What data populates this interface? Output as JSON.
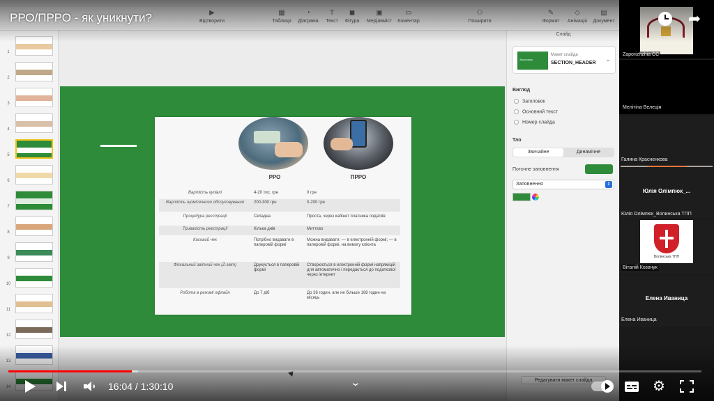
{
  "video": {
    "title": "РРО/ПРРО - як уникнути?",
    "time_current": "16:04",
    "time_total": "1:30:10",
    "time_display": "16:04 / 1:30:10",
    "progress_fraction": 0.178,
    "buffer_fraction": 0.187,
    "accent_color": "#ff0000"
  },
  "keynote": {
    "toolbar": {
      "play": "Відтворити",
      "table": "Таблиця",
      "chart": "Діаграма",
      "text": "Текст",
      "shape": "Фігура",
      "media": "Медіавміст",
      "comment": "Коментар",
      "share": "Поширити",
      "format": "Формат",
      "animate": "Анімація",
      "document": "Документ"
    },
    "navigator": {
      "numbers": [
        "1",
        "2",
        "3",
        "4",
        "5",
        "6",
        "7",
        "8",
        "9",
        "10",
        "11",
        "12",
        "13",
        "14"
      ],
      "selected_index": 4
    },
    "slide": {
      "background_color": "#2e8b3a",
      "image": {
        "col_rro": "РРО",
        "col_prro": "ПРРО",
        "rows": [
          {
            "label": "Вартість купівлі",
            "rro": "4-20 тис. грн",
            "prro": "0 грн"
          },
          {
            "label": "Вартість щомісячного обслуговування",
            "rro": "200-300 грн",
            "prro": "0-200 грн"
          },
          {
            "label": "Процедура реєстрації",
            "rro": "Складна",
            "prro": "Проста, через кабінет платника податків"
          },
          {
            "label": "Тривалість реєстрації",
            "rro": "Кілька днів",
            "prro": "Миттєво"
          },
          {
            "label": "Касовий чек",
            "rro": "Потрібно видавати в паперовій формі",
            "prro": "Можна видавати: — в електронній формі; — в паперовій формі, на вимогу клієнта"
          },
          {
            "label": "Фіскальний звітний чек (Z-звіт)",
            "rro": "Друкується в паперовій формі",
            "prro": "Створюється в електронній формі напряміцій для автоматично і передається до податкової через інтернет"
          },
          {
            "label": "Робота в режимі офлайн",
            "rro": "До 7 діб",
            "prro": "До 36 годин, але не більше 168 годин на місяць"
          }
        ]
      }
    },
    "inspector": {
      "title": "Слайд",
      "layout_label": "Макет слайда",
      "layout_value": "SECTION_HEADER",
      "layout_thumb_text": "Заголовок",
      "appearance_heading": "Вигляд",
      "appearance_options": [
        "Заголовок",
        "Основний текст",
        "Номер слайда"
      ],
      "background_heading": "Тло",
      "segment_static": "Звичайне",
      "segment_dynamic": "Динамічне",
      "current_fill": "Поточне заповнення",
      "fill_type": "Заповнення",
      "fill_color": "#2e8b3a",
      "edit_layout": "Редагувати макет слайда"
    }
  },
  "participants": [
    {
      "name": "Zaporizhzhia CC"
    },
    {
      "name": "Мелітіна Велеція"
    },
    {
      "name": "Галина Красненкова"
    },
    {
      "name": "Юлія Олімпюк_..."
    },
    {
      "name": "Юлія Олімпюк_Волинська ТПП"
    },
    {
      "name": "Віталій Козачук"
    },
    {
      "name": "Волинська ТПП"
    },
    {
      "name": "Елена Иваница"
    },
    {
      "name": "Елена Иваница"
    }
  ]
}
